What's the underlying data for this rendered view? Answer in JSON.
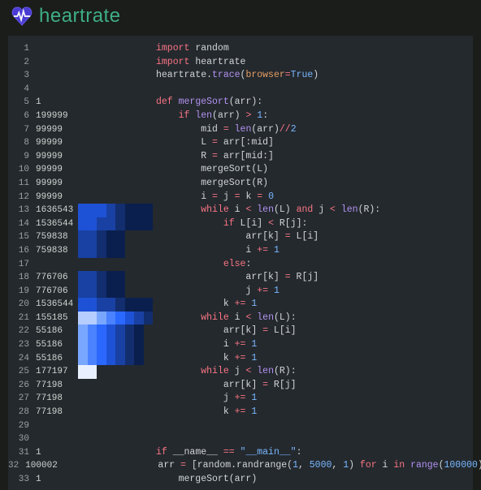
{
  "header": {
    "title": "heartrate"
  },
  "heat_palette": [
    "#0a1f4d",
    "#122e6e",
    "#1940a3",
    "#1e52d6",
    "#2b68ff",
    "#4a82ff",
    "#79a6ff",
    "#b5cdff",
    "#e8f0ff"
  ],
  "lines": [
    {
      "n": 1,
      "count": "",
      "heat": [],
      "tokens": [
        [
          "kw",
          "import"
        ],
        [
          "pu",
          " "
        ],
        [
          "nm",
          "random"
        ]
      ]
    },
    {
      "n": 2,
      "count": "",
      "heat": [],
      "tokens": [
        [
          "kw",
          "import"
        ],
        [
          "pu",
          " "
        ],
        [
          "nm",
          "heartrate"
        ]
      ]
    },
    {
      "n": 3,
      "count": "",
      "heat": [],
      "tokens": [
        [
          "nm",
          "heartrate"
        ],
        [
          "pu",
          "."
        ],
        [
          "fn",
          "trace"
        ],
        [
          "pu",
          "("
        ],
        [
          "kwarg",
          "browser"
        ],
        [
          "op",
          "="
        ],
        [
          "cst",
          "True"
        ],
        [
          "pu",
          ")"
        ]
      ]
    },
    {
      "n": 4,
      "count": "",
      "heat": [],
      "tokens": []
    },
    {
      "n": 5,
      "count": "1",
      "heat": [],
      "tokens": [
        [
          "kw",
          "def"
        ],
        [
          "pu",
          " "
        ],
        [
          "fn",
          "mergeSort"
        ],
        [
          "pu",
          "(arr):"
        ]
      ]
    },
    {
      "n": 6,
      "count": "199999",
      "heat": [],
      "tokens": [
        [
          "pu",
          "    "
        ],
        [
          "kw",
          "if"
        ],
        [
          "pu",
          " "
        ],
        [
          "fn",
          "len"
        ],
        [
          "pu",
          "(arr) "
        ],
        [
          "op",
          ">"
        ],
        [
          "pu",
          " "
        ],
        [
          "num",
          "1"
        ],
        [
          "pu",
          ":"
        ]
      ]
    },
    {
      "n": 7,
      "count": "99999",
      "heat": [],
      "tokens": [
        [
          "pu",
          "        mid "
        ],
        [
          "op",
          "="
        ],
        [
          "pu",
          " "
        ],
        [
          "fn",
          "len"
        ],
        [
          "pu",
          "(arr)"
        ],
        [
          "op",
          "//"
        ],
        [
          "num",
          "2"
        ]
      ]
    },
    {
      "n": 8,
      "count": "99999",
      "heat": [],
      "tokens": [
        [
          "pu",
          "        L "
        ],
        [
          "op",
          "="
        ],
        [
          "pu",
          " arr[:mid]"
        ]
      ]
    },
    {
      "n": 9,
      "count": "99999",
      "heat": [],
      "tokens": [
        [
          "pu",
          "        R "
        ],
        [
          "op",
          "="
        ],
        [
          "pu",
          " arr[mid:]"
        ]
      ]
    },
    {
      "n": 10,
      "count": "99999",
      "heat": [],
      "tokens": [
        [
          "pu",
          "        mergeSort(L)"
        ]
      ]
    },
    {
      "n": 11,
      "count": "99999",
      "heat": [],
      "tokens": [
        [
          "pu",
          "        mergeSort(R)"
        ]
      ]
    },
    {
      "n": 12,
      "count": "99999",
      "heat": [],
      "tokens": [
        [
          "pu",
          "        i "
        ],
        [
          "op",
          "="
        ],
        [
          "pu",
          " j "
        ],
        [
          "op",
          "="
        ],
        [
          "pu",
          " k "
        ],
        [
          "op",
          "="
        ],
        [
          "pu",
          " "
        ],
        [
          "num",
          "0"
        ]
      ]
    },
    {
      "n": 13,
      "count": "1636543",
      "heat": [
        3,
        3,
        3,
        2,
        1,
        0,
        0,
        0
      ],
      "tokens": [
        [
          "pu",
          "        "
        ],
        [
          "kw",
          "while"
        ],
        [
          "pu",
          " i "
        ],
        [
          "op",
          "<"
        ],
        [
          "pu",
          " "
        ],
        [
          "fn",
          "len"
        ],
        [
          "pu",
          "(L) "
        ],
        [
          "kw",
          "and"
        ],
        [
          "pu",
          " j "
        ],
        [
          "op",
          "<"
        ],
        [
          "pu",
          " "
        ],
        [
          "fn",
          "len"
        ],
        [
          "pu",
          "(R):"
        ]
      ]
    },
    {
      "n": 14,
      "count": "1536544",
      "heat": [
        3,
        3,
        2,
        2,
        1,
        0,
        0,
        0
      ],
      "tokens": [
        [
          "pu",
          "            "
        ],
        [
          "kw",
          "if"
        ],
        [
          "pu",
          " L[i] "
        ],
        [
          "op",
          "<"
        ],
        [
          "pu",
          " R[j]:"
        ]
      ]
    },
    {
      "n": 15,
      "count": "759838",
      "heat": [
        2,
        2,
        1,
        0,
        0,
        -1,
        -1,
        -1
      ],
      "tokens": [
        [
          "pu",
          "                arr[k] "
        ],
        [
          "op",
          "="
        ],
        [
          "pu",
          " L[i]"
        ]
      ]
    },
    {
      "n": 16,
      "count": "759838",
      "heat": [
        2,
        2,
        1,
        0,
        0,
        -1,
        -1,
        -1
      ],
      "tokens": [
        [
          "pu",
          "                i "
        ],
        [
          "op",
          "+="
        ],
        [
          "pu",
          " "
        ],
        [
          "num",
          "1"
        ]
      ]
    },
    {
      "n": 17,
      "count": "",
      "heat": [
        -1,
        -1,
        -1,
        -1,
        -1,
        -1,
        -1,
        -1
      ],
      "tokens": [
        [
          "pu",
          "            "
        ],
        [
          "kw",
          "else"
        ],
        [
          "pu",
          ":"
        ]
      ]
    },
    {
      "n": 18,
      "count": "776706",
      "heat": [
        2,
        2,
        1,
        0,
        0,
        -1,
        -1,
        -1
      ],
      "tokens": [
        [
          "pu",
          "                arr[k] "
        ],
        [
          "op",
          "="
        ],
        [
          "pu",
          " R[j]"
        ]
      ]
    },
    {
      "n": 19,
      "count": "776706",
      "heat": [
        2,
        2,
        1,
        0,
        0,
        -1,
        -1,
        -1
      ],
      "tokens": [
        [
          "pu",
          "                j "
        ],
        [
          "op",
          "+="
        ],
        [
          "pu",
          " "
        ],
        [
          "num",
          "1"
        ]
      ]
    },
    {
      "n": 20,
      "count": "1536544",
      "heat": [
        3,
        3,
        2,
        2,
        1,
        0,
        0,
        0
      ],
      "tokens": [
        [
          "pu",
          "            k "
        ],
        [
          "op",
          "+="
        ],
        [
          "pu",
          " "
        ],
        [
          "num",
          "1"
        ]
      ]
    },
    {
      "n": 21,
      "count": "155185",
      "heat": [
        7,
        7,
        6,
        5,
        4,
        3,
        2,
        1
      ],
      "tokens": [
        [
          "pu",
          "        "
        ],
        [
          "kw",
          "while"
        ],
        [
          "pu",
          " i "
        ],
        [
          "op",
          "<"
        ],
        [
          "pu",
          " "
        ],
        [
          "fn",
          "len"
        ],
        [
          "pu",
          "(L):"
        ]
      ]
    },
    {
      "n": 22,
      "count": "55186",
      "heat": [
        6,
        5,
        4,
        3,
        2,
        1,
        0,
        -1
      ],
      "tokens": [
        [
          "pu",
          "            arr[k] "
        ],
        [
          "op",
          "="
        ],
        [
          "pu",
          " L[i]"
        ]
      ]
    },
    {
      "n": 23,
      "count": "55186",
      "heat": [
        6,
        5,
        4,
        3,
        2,
        1,
        0,
        -1
      ],
      "tokens": [
        [
          "pu",
          "            i "
        ],
        [
          "op",
          "+="
        ],
        [
          "pu",
          " "
        ],
        [
          "num",
          "1"
        ]
      ]
    },
    {
      "n": 24,
      "count": "55186",
      "heat": [
        6,
        5,
        4,
        3,
        2,
        1,
        0,
        -1
      ],
      "tokens": [
        [
          "pu",
          "            k "
        ],
        [
          "op",
          "+="
        ],
        [
          "pu",
          " "
        ],
        [
          "num",
          "1"
        ]
      ]
    },
    {
      "n": 25,
      "count": "177197",
      "heat": [
        8,
        8,
        -1,
        -1,
        -1,
        -1,
        -1,
        -1
      ],
      "tokens": [
        [
          "pu",
          "        "
        ],
        [
          "kw",
          "while"
        ],
        [
          "pu",
          " j "
        ],
        [
          "op",
          "<"
        ],
        [
          "pu",
          " "
        ],
        [
          "fn",
          "len"
        ],
        [
          "pu",
          "(R):"
        ]
      ]
    },
    {
      "n": 26,
      "count": "77198",
      "heat": [
        -1,
        -1,
        -1,
        -1,
        -1,
        -1,
        -1,
        -1
      ],
      "tokens": [
        [
          "pu",
          "            arr[k] "
        ],
        [
          "op",
          "="
        ],
        [
          "pu",
          " R[j]"
        ]
      ]
    },
    {
      "n": 27,
      "count": "77198",
      "heat": [
        -1,
        -1,
        -1,
        -1,
        -1,
        -1,
        -1,
        -1
      ],
      "tokens": [
        [
          "pu",
          "            j "
        ],
        [
          "op",
          "+="
        ],
        [
          "pu",
          " "
        ],
        [
          "num",
          "1"
        ]
      ]
    },
    {
      "n": 28,
      "count": "77198",
      "heat": [
        -1,
        -1,
        -1,
        -1,
        -1,
        -1,
        -1,
        -1
      ],
      "tokens": [
        [
          "pu",
          "            k "
        ],
        [
          "op",
          "+="
        ],
        [
          "pu",
          " "
        ],
        [
          "num",
          "1"
        ]
      ]
    },
    {
      "n": 29,
      "count": "",
      "heat": [],
      "tokens": []
    },
    {
      "n": 30,
      "count": "",
      "heat": [],
      "tokens": []
    },
    {
      "n": 31,
      "count": "1",
      "heat": [],
      "tokens": [
        [
          "kw",
          "if"
        ],
        [
          "pu",
          " __name__ "
        ],
        [
          "op",
          "=="
        ],
        [
          "pu",
          " "
        ],
        [
          "str",
          "\"__main__\""
        ],
        [
          "pu",
          ":"
        ]
      ]
    },
    {
      "n": 32,
      "count": "100002",
      "heat": [],
      "tokens": [
        [
          "pu",
          "    arr "
        ],
        [
          "op",
          "="
        ],
        [
          "pu",
          " [random.randrange("
        ],
        [
          "num",
          "1"
        ],
        [
          "pu",
          ", "
        ],
        [
          "num",
          "5000"
        ],
        [
          "pu",
          ", "
        ],
        [
          "num",
          "1"
        ],
        [
          "pu",
          ") "
        ],
        [
          "kw",
          "for"
        ],
        [
          "pu",
          " i "
        ],
        [
          "kw",
          "in"
        ],
        [
          "pu",
          " "
        ],
        [
          "fn",
          "range"
        ],
        [
          "pu",
          "("
        ],
        [
          "num",
          "100000"
        ],
        [
          "pu",
          ")]"
        ]
      ]
    },
    {
      "n": 33,
      "count": "1",
      "heat": [],
      "tokens": [
        [
          "pu",
          "    mergeSort(arr)"
        ]
      ]
    }
  ]
}
